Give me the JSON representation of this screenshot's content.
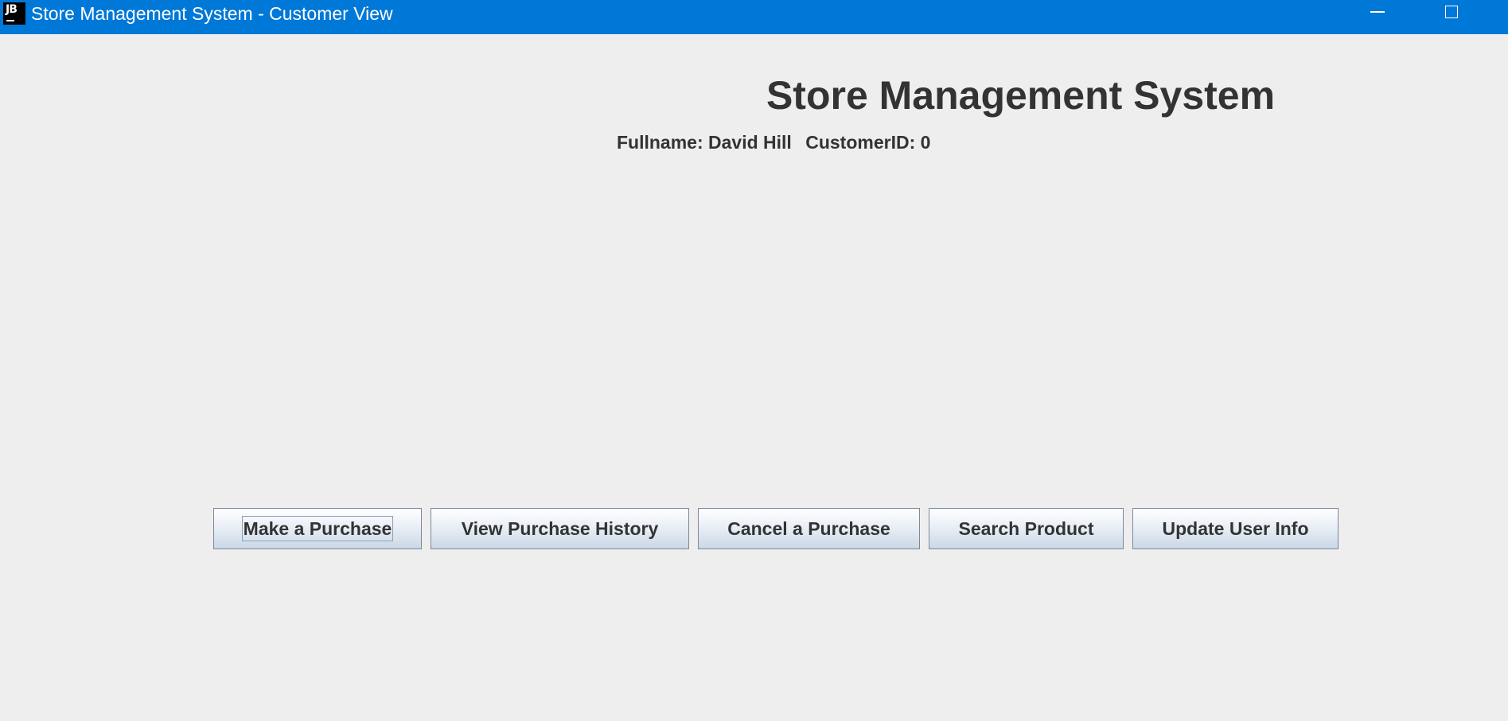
{
  "window": {
    "title": "Store Management System - Customer View",
    "icon_text": "JB",
    "icon_name": "jetbrains-app-icon",
    "accent_color": "#0078d7"
  },
  "header": {
    "title": "Store Management System",
    "fullname": "Fullname: David Hill",
    "customer_id": "CustomerID: 0"
  },
  "actions": {
    "make_purchase": "Make a Purchase",
    "view_history": "View Purchase History",
    "cancel_purchase": "Cancel a Purchase",
    "search_product": "Search Product",
    "update_user_info": "Update User Info"
  }
}
